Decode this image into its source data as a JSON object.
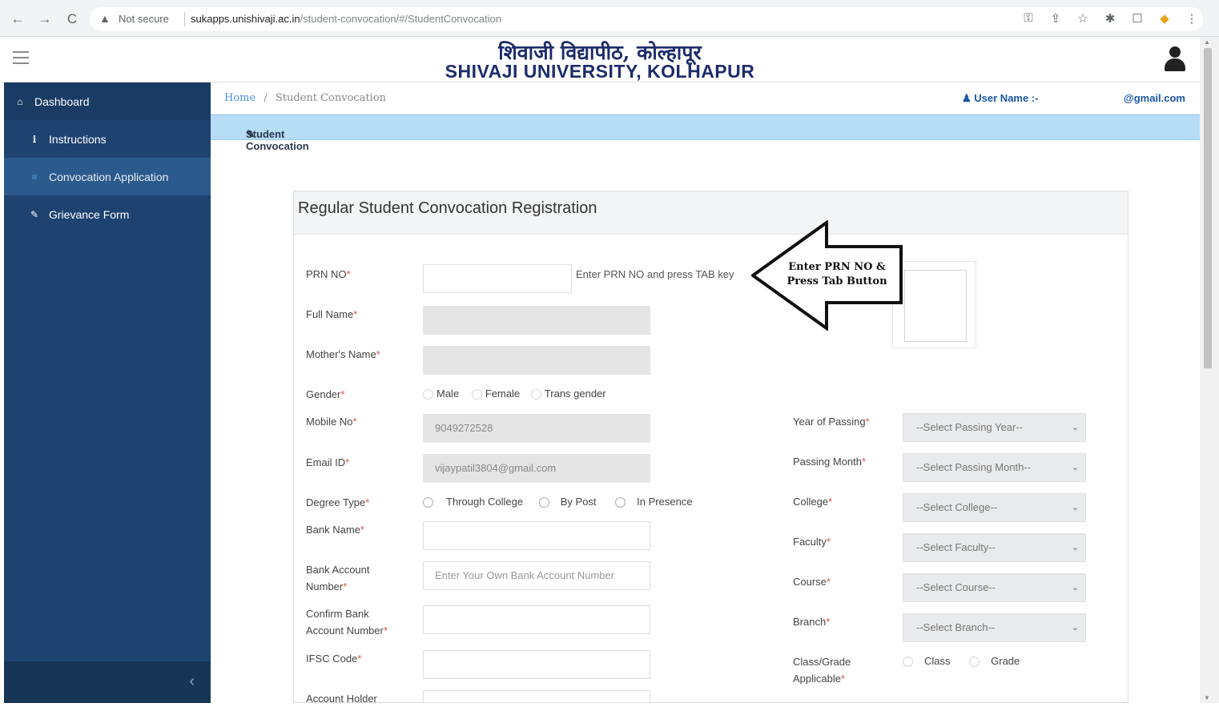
{
  "browser": {
    "back": "←",
    "forward": "→",
    "reload": "C",
    "warning_icon": "▲",
    "not_secure": "Not secure",
    "url_host": "sukapps.unishivaji.ac.in",
    "url_path": "/student-convocation/#/StudentConvocation",
    "icons": [
      "key-icon",
      "share-icon",
      "star-icon",
      "pin-icon",
      "window-icon",
      "extension-icon",
      "menu-icon"
    ],
    "icon_glyphs": [
      "⚿",
      "⇪",
      "☆",
      "✱",
      "☐",
      "◆",
      "⋮"
    ]
  },
  "header": {
    "title_hindi": "शिवाजी विद्यापीठ, कोल्हापूर",
    "title_english": "SHIVAJI UNIVERSITY, KOLHAPUR"
  },
  "sidebar": {
    "items": [
      {
        "icon": "⌂",
        "label": "Dashboard"
      },
      {
        "icon": "ℹ",
        "label": "Instructions"
      },
      {
        "icon": "≡",
        "label": "Convocation Application"
      },
      {
        "icon": "✎",
        "label": "Grievance Form"
      }
    ],
    "collapse_icon": "‹"
  },
  "breadcrumb": {
    "home": "Home",
    "separator": "/",
    "current": "Student Convocation"
  },
  "user": {
    "label": "User Name :-",
    "email": "@gmail.com"
  },
  "section_title": "Student Convocation",
  "form": {
    "heading": "Regular Student Convocation Registration",
    "required_mark": "*",
    "prn_label": "PRN NO",
    "prn_hint": "Enter PRN NO and press TAB key",
    "fullname_label": "Full Name",
    "mother_label": "Mother's Name",
    "gender_label": "Gender",
    "gender_options": [
      "Male",
      "Female",
      "Trans gender"
    ],
    "mobile_label": "Mobile No",
    "mobile_value": "9049272528",
    "email_label": "Email ID",
    "email_value": "vijaypatil3804@gmail.com",
    "degree_label": "Degree Type",
    "degree_options": [
      "Through College",
      "By Post",
      "In Presence"
    ],
    "bank_name_label": "Bank Name",
    "bank_acc_label_1": "Bank Account",
    "bank_acc_label_2": "Number",
    "bank_acc_placeholder": "Enter Your Own Bank Account Number",
    "confirm_acc_label_1": "Confirm Bank",
    "confirm_acc_label_2": "Account Number",
    "ifsc_label": "IFSC Code",
    "holder_label": "Account Holder",
    "year_label": "Year of Passing",
    "year_select": "--Select Passing Year--",
    "month_label": "Passing Month",
    "month_select": "--Select Passing Month--",
    "college_label": "College",
    "college_select": "--Select College--",
    "faculty_label": "Faculty",
    "faculty_select": "--Select Faculty--",
    "course_label": "Course",
    "course_select": "--Select Course--",
    "branch_label": "Branch",
    "branch_select": "--Select Branch--",
    "class_label_1": "Class/Grade",
    "class_label_2": "Applicable",
    "class_options": [
      "Class",
      "Grade"
    ],
    "select_arrow": "⌄"
  },
  "annotation": {
    "line1": "Enter PRN NO &",
    "line2": "Press Tab Button"
  }
}
